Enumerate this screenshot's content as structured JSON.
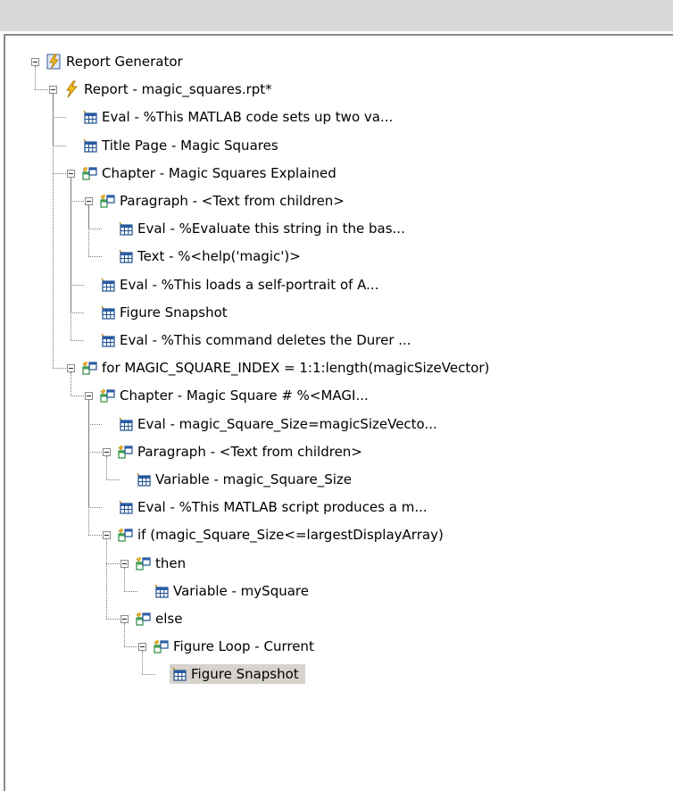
{
  "tree": {
    "items": [
      {
        "label": "Report Generator",
        "icon": "report-generator-icon",
        "level": 0
      },
      {
        "label": "Report - magic_squares.rpt*",
        "icon": "report-lightning-icon",
        "level": 1
      },
      {
        "label": "Eval - %This MATLAB code sets up two va...",
        "icon": "table-component-icon",
        "level": 2
      },
      {
        "label": "Title Page - Magic Squares",
        "icon": "table-component-icon",
        "level": 2
      },
      {
        "label": "Chapter - Magic Squares Explained",
        "icon": "component-group-icon",
        "level": 2
      },
      {
        "label": "Paragraph - <Text from children>",
        "icon": "component-group-icon",
        "level": 3
      },
      {
        "label": "Eval - %Evaluate this string in the bas...",
        "icon": "table-component-icon",
        "level": 4
      },
      {
        "label": "Text - %<help('magic')>",
        "icon": "table-component-icon",
        "level": 4
      },
      {
        "label": "Eval - %This loads a self-portrait of A...",
        "icon": "table-component-icon",
        "level": 3
      },
      {
        "label": "Figure Snapshot",
        "icon": "table-component-icon",
        "level": 3
      },
      {
        "label": "Eval - %This command deletes the Durer ...",
        "icon": "table-component-icon",
        "level": 3
      },
      {
        "label": "for MAGIC_SQUARE_INDEX = 1:1:length(magicSizeVector)",
        "icon": "component-group-icon",
        "level": 2
      },
      {
        "label": "Chapter - Magic Square # %<MAGI...",
        "icon": "component-group-icon",
        "level": 3
      },
      {
        "label": "Eval - magic_Square_Size=magicSizeVecto...",
        "icon": "table-component-icon",
        "level": 4
      },
      {
        "label": "Paragraph - <Text from children>",
        "icon": "component-group-icon",
        "level": 4
      },
      {
        "label": "Variable - magic_Square_Size",
        "icon": "table-component-icon",
        "level": 5
      },
      {
        "label": "Eval - %This MATLAB script produces a m...",
        "icon": "table-component-icon",
        "level": 4
      },
      {
        "label": "if (magic_Square_Size<=largestDisplayArray)",
        "icon": "component-group-icon",
        "level": 4
      },
      {
        "label": "then",
        "icon": "component-group-icon",
        "level": 5
      },
      {
        "label": "Variable - mySquare",
        "icon": "table-component-icon",
        "level": 6
      },
      {
        "label": "else",
        "icon": "component-group-icon",
        "level": 5
      },
      {
        "label": "Figure Loop - Current",
        "icon": "component-group-icon",
        "level": 6
      },
      {
        "label": "Figure Snapshot",
        "icon": "table-component-icon",
        "level": 7,
        "selected": true
      }
    ]
  }
}
